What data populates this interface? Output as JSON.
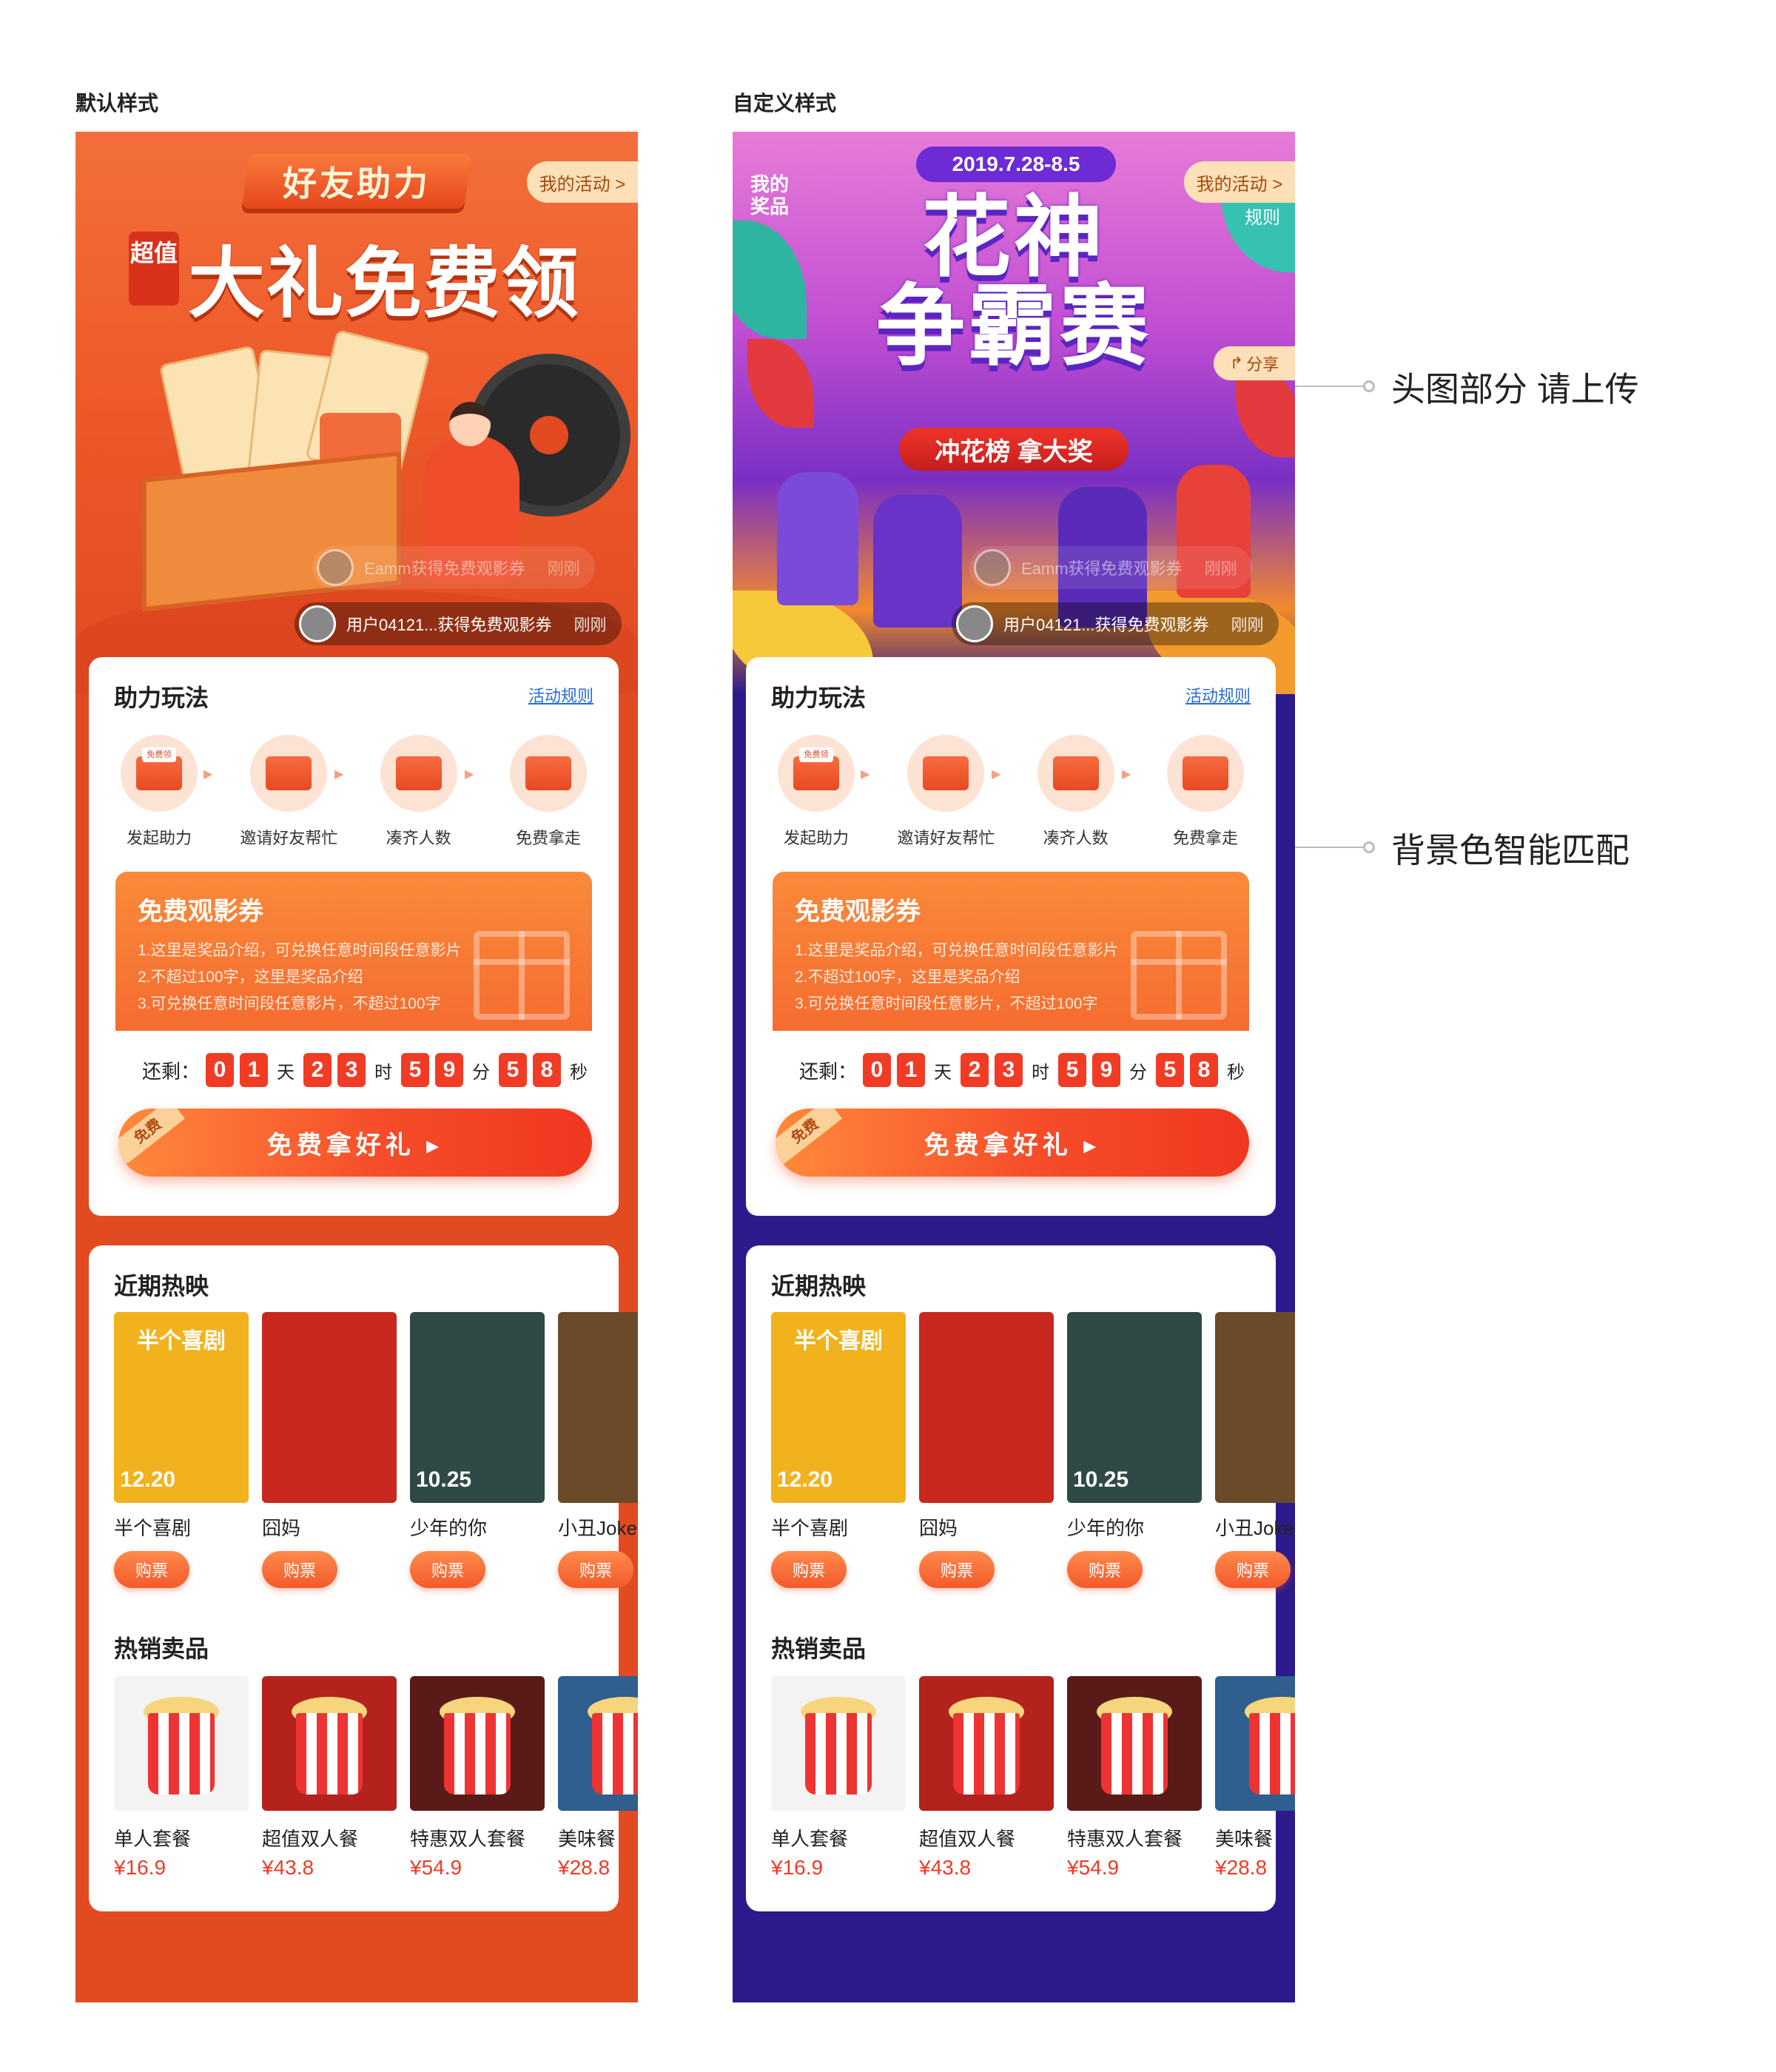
{
  "captions": {
    "default": "默认样式",
    "custom": "自定义样式"
  },
  "header_default": {
    "title_banner": "好友助力",
    "title_tag": "超值",
    "title_main": "大礼免费领",
    "my_activity": "我的活动 >"
  },
  "header_custom": {
    "date": "2019.7.28-8.5",
    "title_line1": "花神",
    "title_line2": "争霸赛",
    "subtitle": "冲花榜  拿大奖",
    "my_prize": "我的奖品",
    "my_activity": "我的活动 >",
    "rules": "规则",
    "share": "分享"
  },
  "toasts": {
    "faded": {
      "text": "Eamm获得免费观影券",
      "time": "刚刚"
    },
    "main": {
      "text": "用户04121...获得免费观影券",
      "time": "刚刚"
    }
  },
  "play": {
    "title": "助力玩法",
    "rules_link": "活动规则",
    "steps": [
      {
        "label": "发起助力",
        "icon": "free-claim-icon",
        "tag": "免费领"
      },
      {
        "label": "邀请好友帮忙",
        "icon": "envelope-icon"
      },
      {
        "label": "凑齐人数",
        "icon": "id-card-icon"
      },
      {
        "label": "免费拿走",
        "icon": "gift-card-icon"
      }
    ]
  },
  "prize": {
    "title": "免费观影券",
    "lines": [
      "1.这里是奖品介绍，可兑换任意时间段任意影片",
      "2.不超过100字，这里是奖品介绍",
      "3.可兑换任意时间段任意影片，不超过100字"
    ]
  },
  "countdown": {
    "label": "还剩：",
    "days": [
      "0",
      "1"
    ],
    "day_unit": "天",
    "hours": [
      "2",
      "3"
    ],
    "hour_unit": "时",
    "minutes": [
      "5",
      "9"
    ],
    "minute_unit": "分",
    "seconds": [
      "5",
      "8"
    ],
    "second_unit": "秒"
  },
  "cta": {
    "label": "免费拿好礼 ▸",
    "tag": "免费"
  },
  "movies_section": {
    "title": "近期热映",
    "buy_label": "购票",
    "items": [
      {
        "name": "半个喜剧",
        "poster_title": "半个喜剧",
        "poster_date": "12.20",
        "color": "#f2b21d"
      },
      {
        "name": "囧妈",
        "poster_title": "",
        "poster_date": "",
        "color": "#c8281f"
      },
      {
        "name": "少年的你",
        "poster_title": "",
        "poster_date": "10.25",
        "color": "#2f4a46"
      },
      {
        "name": "小丑Joker",
        "poster_title": "",
        "poster_date": "",
        "color": "#6b4a2a"
      }
    ]
  },
  "foods_section": {
    "title": "热销卖品",
    "items": [
      {
        "name": "单人套餐",
        "price": "¥16.9",
        "color": "#f3f3f3"
      },
      {
        "name": "超值双人餐",
        "price": "¥43.8",
        "color": "#b3221c"
      },
      {
        "name": "特惠双人套餐",
        "price": "¥54.9",
        "color": "#5a1a18"
      },
      {
        "name": "美味餐",
        "price": "¥28.8",
        "color": "#2f5e8f"
      }
    ]
  },
  "notes": {
    "header": "头图部分 请上传",
    "background": "背景色智能匹配"
  },
  "colors": {
    "default_bg": "#e24a22",
    "custom_bg": "#2c1a8c",
    "accent": "#f03a25"
  }
}
